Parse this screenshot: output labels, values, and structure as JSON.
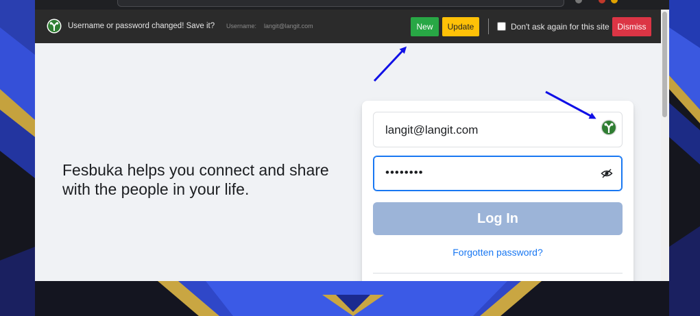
{
  "pw_bar": {
    "message": "Username or password changed! Save it?",
    "username_label": "Username:",
    "username_value": "langit@langit.com",
    "new_label": "New",
    "update_label": "Update",
    "dont_ask_label": "Don't ask again for this site",
    "dismiss_label": "Dismiss",
    "colors": {
      "new": "#28a745",
      "update": "#ffc107",
      "dismiss": "#dc3545"
    }
  },
  "page": {
    "tagline": "Fesbuka helps you connect and share with the people in your life."
  },
  "login": {
    "email_value": "langit@langit.com",
    "password_value": "••••••••",
    "login_label": "Log In",
    "forgot_label": "Forgotten password?",
    "accent": "#1877f2"
  },
  "icons": [
    "password-manager-logo-icon",
    "eye-slash-icon",
    "annotation-arrow-icon"
  ]
}
